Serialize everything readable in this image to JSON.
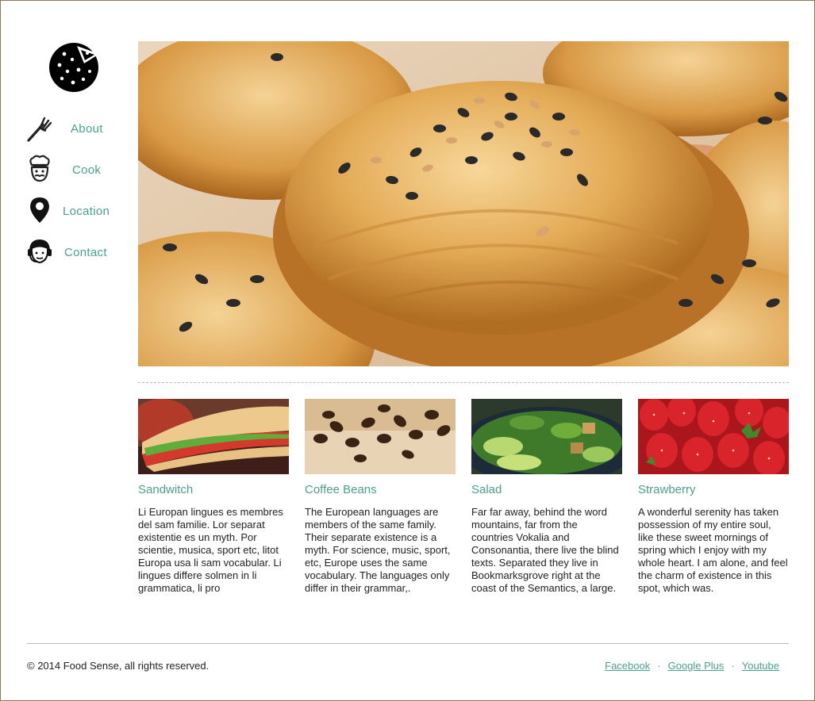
{
  "nav": {
    "items": [
      {
        "label": "About",
        "icon": "fork-icon"
      },
      {
        "label": "Cook",
        "icon": "chef-icon"
      },
      {
        "label": "Location",
        "icon": "map-pin-icon"
      },
      {
        "label": "Contact",
        "icon": "headset-icon"
      }
    ]
  },
  "cards": [
    {
      "title": "Sandwitch",
      "text": "Li Europan lingues es membres del sam familie. Lor separat existentie es un myth. Por scientie, musica, sport etc, litot Europa usa li sam vocabular. Li lingues differe solmen in li grammatica, li pro"
    },
    {
      "title": "Coffee Beans",
      "text": "The European languages are members of the same family. Their separate existence is a myth. For science, music, sport, etc, Europe uses the same vocabulary. The languages only differ in their grammar,."
    },
    {
      "title": "Salad",
      "text": "Far far away, behind the word mountains, far from the countries Vokalia and Consonantia, there live the blind texts. Separated they live in Bookmarksgrove right at the coast of the Semantics, a large."
    },
    {
      "title": "Strawberry",
      "text": "A wonderful serenity has taken possession of my entire soul, like these sweet mornings of spring which I enjoy with my whole heart. I am alone, and feel the charm of existence in this spot, which was."
    }
  ],
  "footer": {
    "copyright": "© 2014 Food Sense, all rights reserved.",
    "links": [
      "Facebook",
      "Google Plus",
      "Youtube"
    ],
    "separator": "·"
  },
  "colors": {
    "accent": "#4aa18c",
    "text": "#222222",
    "border": "#8a7a55"
  }
}
